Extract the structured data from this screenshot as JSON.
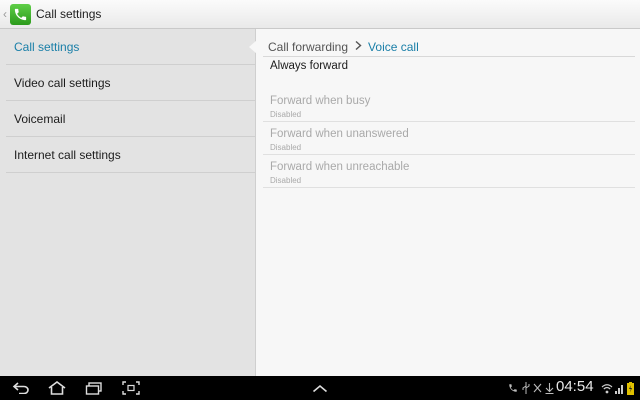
{
  "actionbar": {
    "title": "Call settings",
    "app_icon": "phone-icon"
  },
  "sidebar": {
    "items": [
      {
        "label": "Call settings",
        "selected": true
      },
      {
        "label": "Video call settings",
        "selected": false
      },
      {
        "label": "Voicemail",
        "selected": false
      },
      {
        "label": "Internet call settings",
        "selected": false
      }
    ]
  },
  "breadcrumb": {
    "parent": "Call forwarding",
    "separator_icon": "chevron-right-icon",
    "current": "Voice call"
  },
  "options": [
    {
      "title": "Always forward",
      "subtitle": "",
      "enabled": true
    },
    {
      "title": "Forward when busy",
      "subtitle": "Disabled",
      "enabled": false
    },
    {
      "title": "Forward when unanswered",
      "subtitle": "Disabled",
      "enabled": false
    },
    {
      "title": "Forward when unreachable",
      "subtitle": "Disabled",
      "enabled": false
    }
  ],
  "system_bar": {
    "clock": "04:54",
    "nav_icons": [
      "back-icon",
      "home-icon",
      "recent-apps-icon",
      "screenshot-icon",
      "up-chevron-icon"
    ],
    "status_icons": [
      "call-icon",
      "usb-icon",
      "usb-debug-icon",
      "download-icon",
      "wifi-icon",
      "signal-icon",
      "battery-icon"
    ]
  },
  "colors": {
    "accent": "#1a7fa8",
    "sidebar_bg": "#e3e3e3",
    "content_bg": "#f7f7f7",
    "disabled_text": "#a9a9a9"
  }
}
